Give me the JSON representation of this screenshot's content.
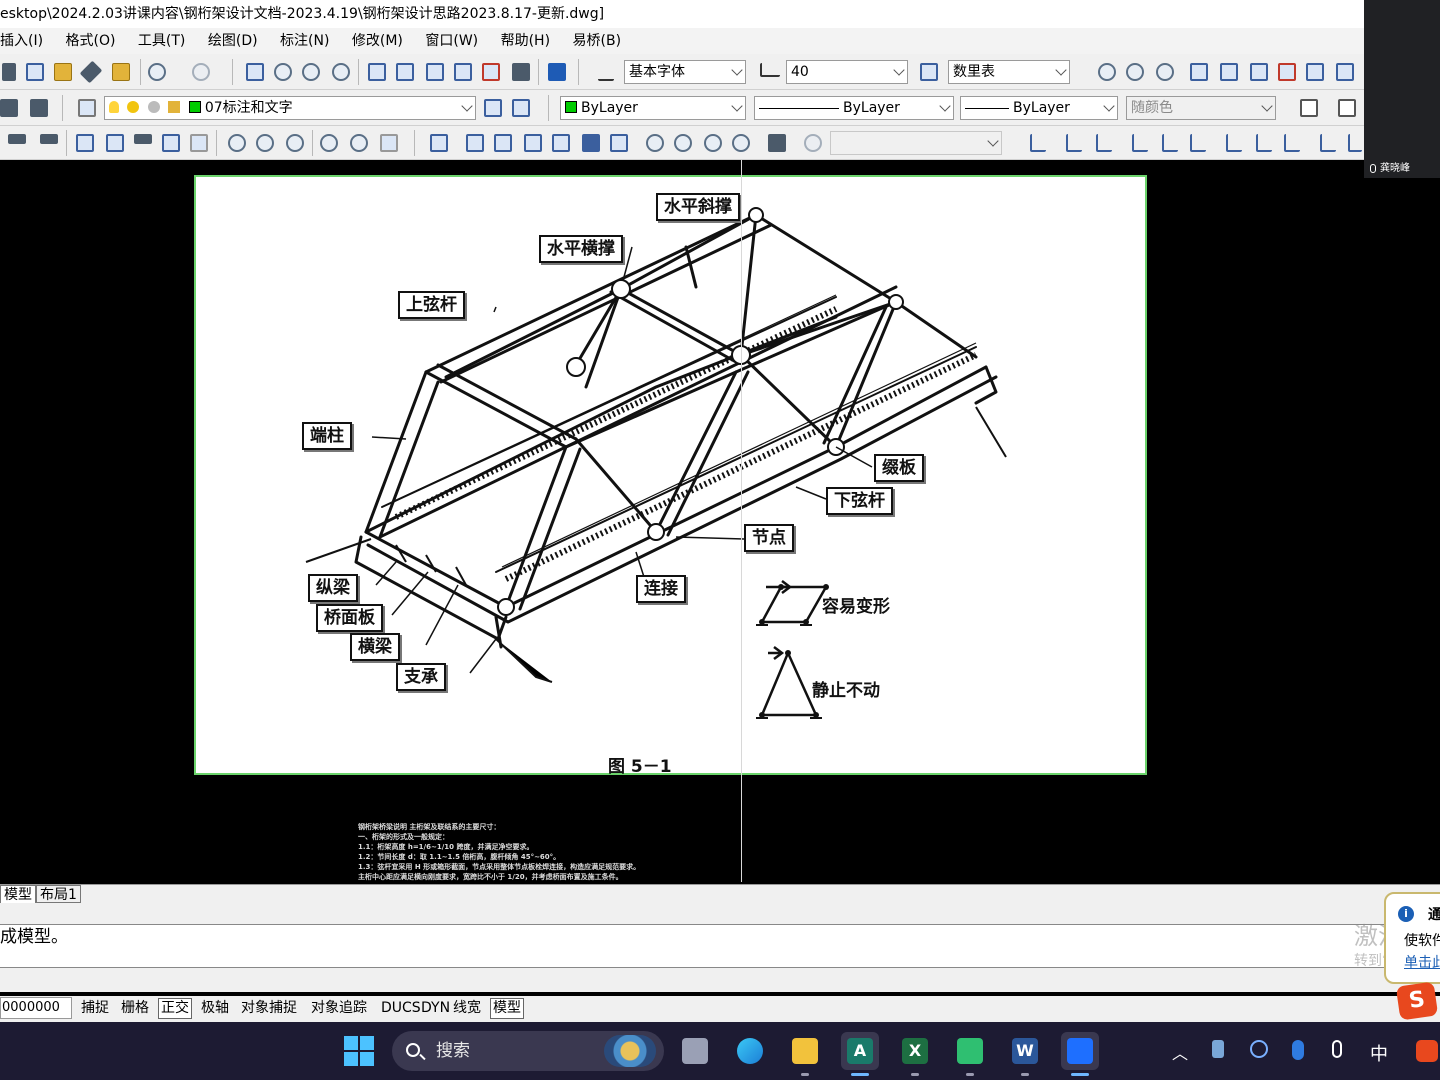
{
  "window": {
    "title": "esktop\\2024.2.03讲课内容\\钢桁架设计文档-2023.4.19\\钢桁架设计思路2023.8.17-更新.dwg]"
  },
  "menu": [
    "插入(I)",
    "格式(O)",
    "工具(T)",
    "绘图(D)",
    "标注(N)",
    "修改(M)",
    "窗口(W)",
    "帮助(H)",
    "易桥(B)"
  ],
  "video_panel": {
    "participant": "龚晓峰"
  },
  "toolbar": {
    "text_style": "基本字体",
    "text_height": "40",
    "table_style": "数里表",
    "layer": "07标注和文字",
    "color": "ByLayer",
    "linetype": "ByLayer",
    "lineweight": "ByLayer",
    "plot_style": "随颜色"
  },
  "drawing": {
    "labels": {
      "horizontal_brace": "水平斜撑",
      "horizontal_strut": "水平横撑",
      "top_chord": "上弦杆",
      "end_post": "端柱",
      "batten_plate": "缀板",
      "bottom_chord": "下弦杆",
      "node": "节点",
      "connection": "连接",
      "stringer": "纵梁",
      "deck_slab": "桥面板",
      "floor_beam": "横梁",
      "bearing": "支承",
      "easy_deform": "容易变形",
      "stationary": "静止不动"
    },
    "caption": "图 5－1",
    "notes": [
      "钢桁架桥梁说明  主桁架及联结系的主要尺寸：",
      "一、桁架的形式及一般规定：",
      "1.1：桁架高度 h=1/6~1/10 跨度，并满足净空要求。",
      "1.2：节间长度 d：取 1.1~1.5 倍桁高，腹杆倾角 45°~60°。",
      "1.3：弦杆宜采用 H 形或箱形截面，节点采用整体节点板栓焊连接，构造应满足规范要求。",
      "     主桁中心距应满足横向刚度要求，宽跨比不小于 1/20，并考虑桥面布置及施工条件。"
    ]
  },
  "tabs": {
    "model": "模型",
    "layout1": "布局1"
  },
  "command": {
    "history": "成模型。"
  },
  "status": {
    "coords": "0000000",
    "buttons": [
      "捕捉",
      "栅格",
      "正交",
      "极轴",
      "对象捕捉",
      "对象追踪",
      "DUCS",
      "DYN",
      "线宽",
      "模型"
    ]
  },
  "notification": {
    "title": "通",
    "line1": "使软件",
    "link": "单击此"
  },
  "watermark": {
    "line1": "激活 W",
    "line2": "转到“设"
  },
  "taskbar": {
    "search_placeholder": "搜索",
    "ime": "中"
  },
  "colors": {
    "accent_green": "#6bd36b",
    "taskbar": "#1d1b33",
    "win_blue": "#4cc2ff"
  }
}
